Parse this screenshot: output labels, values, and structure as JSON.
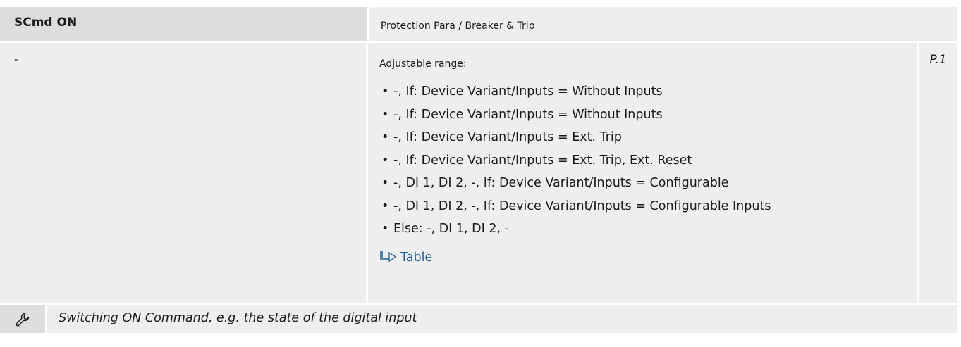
{
  "parameter": {
    "name": "SCmd ON",
    "path": "Protection Para / Breaker & Trip",
    "default_value": "-",
    "access_level": "P.1"
  },
  "range": {
    "title": "Adjustable range:",
    "items": [
      "-, If: Device Variant/Inputs = Without Inputs",
      "-, If: Device Variant/Inputs = Without Inputs",
      "-, If: Device Variant/Inputs = Ext. Trip",
      "-, If: Device Variant/Inputs = Ext. Trip, Ext. Reset",
      "-, DI 1, DI 2, -, If: Device Variant/Inputs = Configurable",
      "-, DI 1, DI 2, -, If: Device Variant/Inputs = Configurable Inputs",
      "Else:  -, DI 1, DI 2, -"
    ],
    "bullet": "•",
    "link_label": "Table",
    "link_icon": "table-reference-arrow-icon"
  },
  "description": {
    "icon": "wrench-icon",
    "text": "Switching ON Command, e.g. the state of the digital input"
  },
  "colors": {
    "header_dark": "#dddddd",
    "cell_light": "#eeeeee",
    "link": "#1f5d9a"
  }
}
